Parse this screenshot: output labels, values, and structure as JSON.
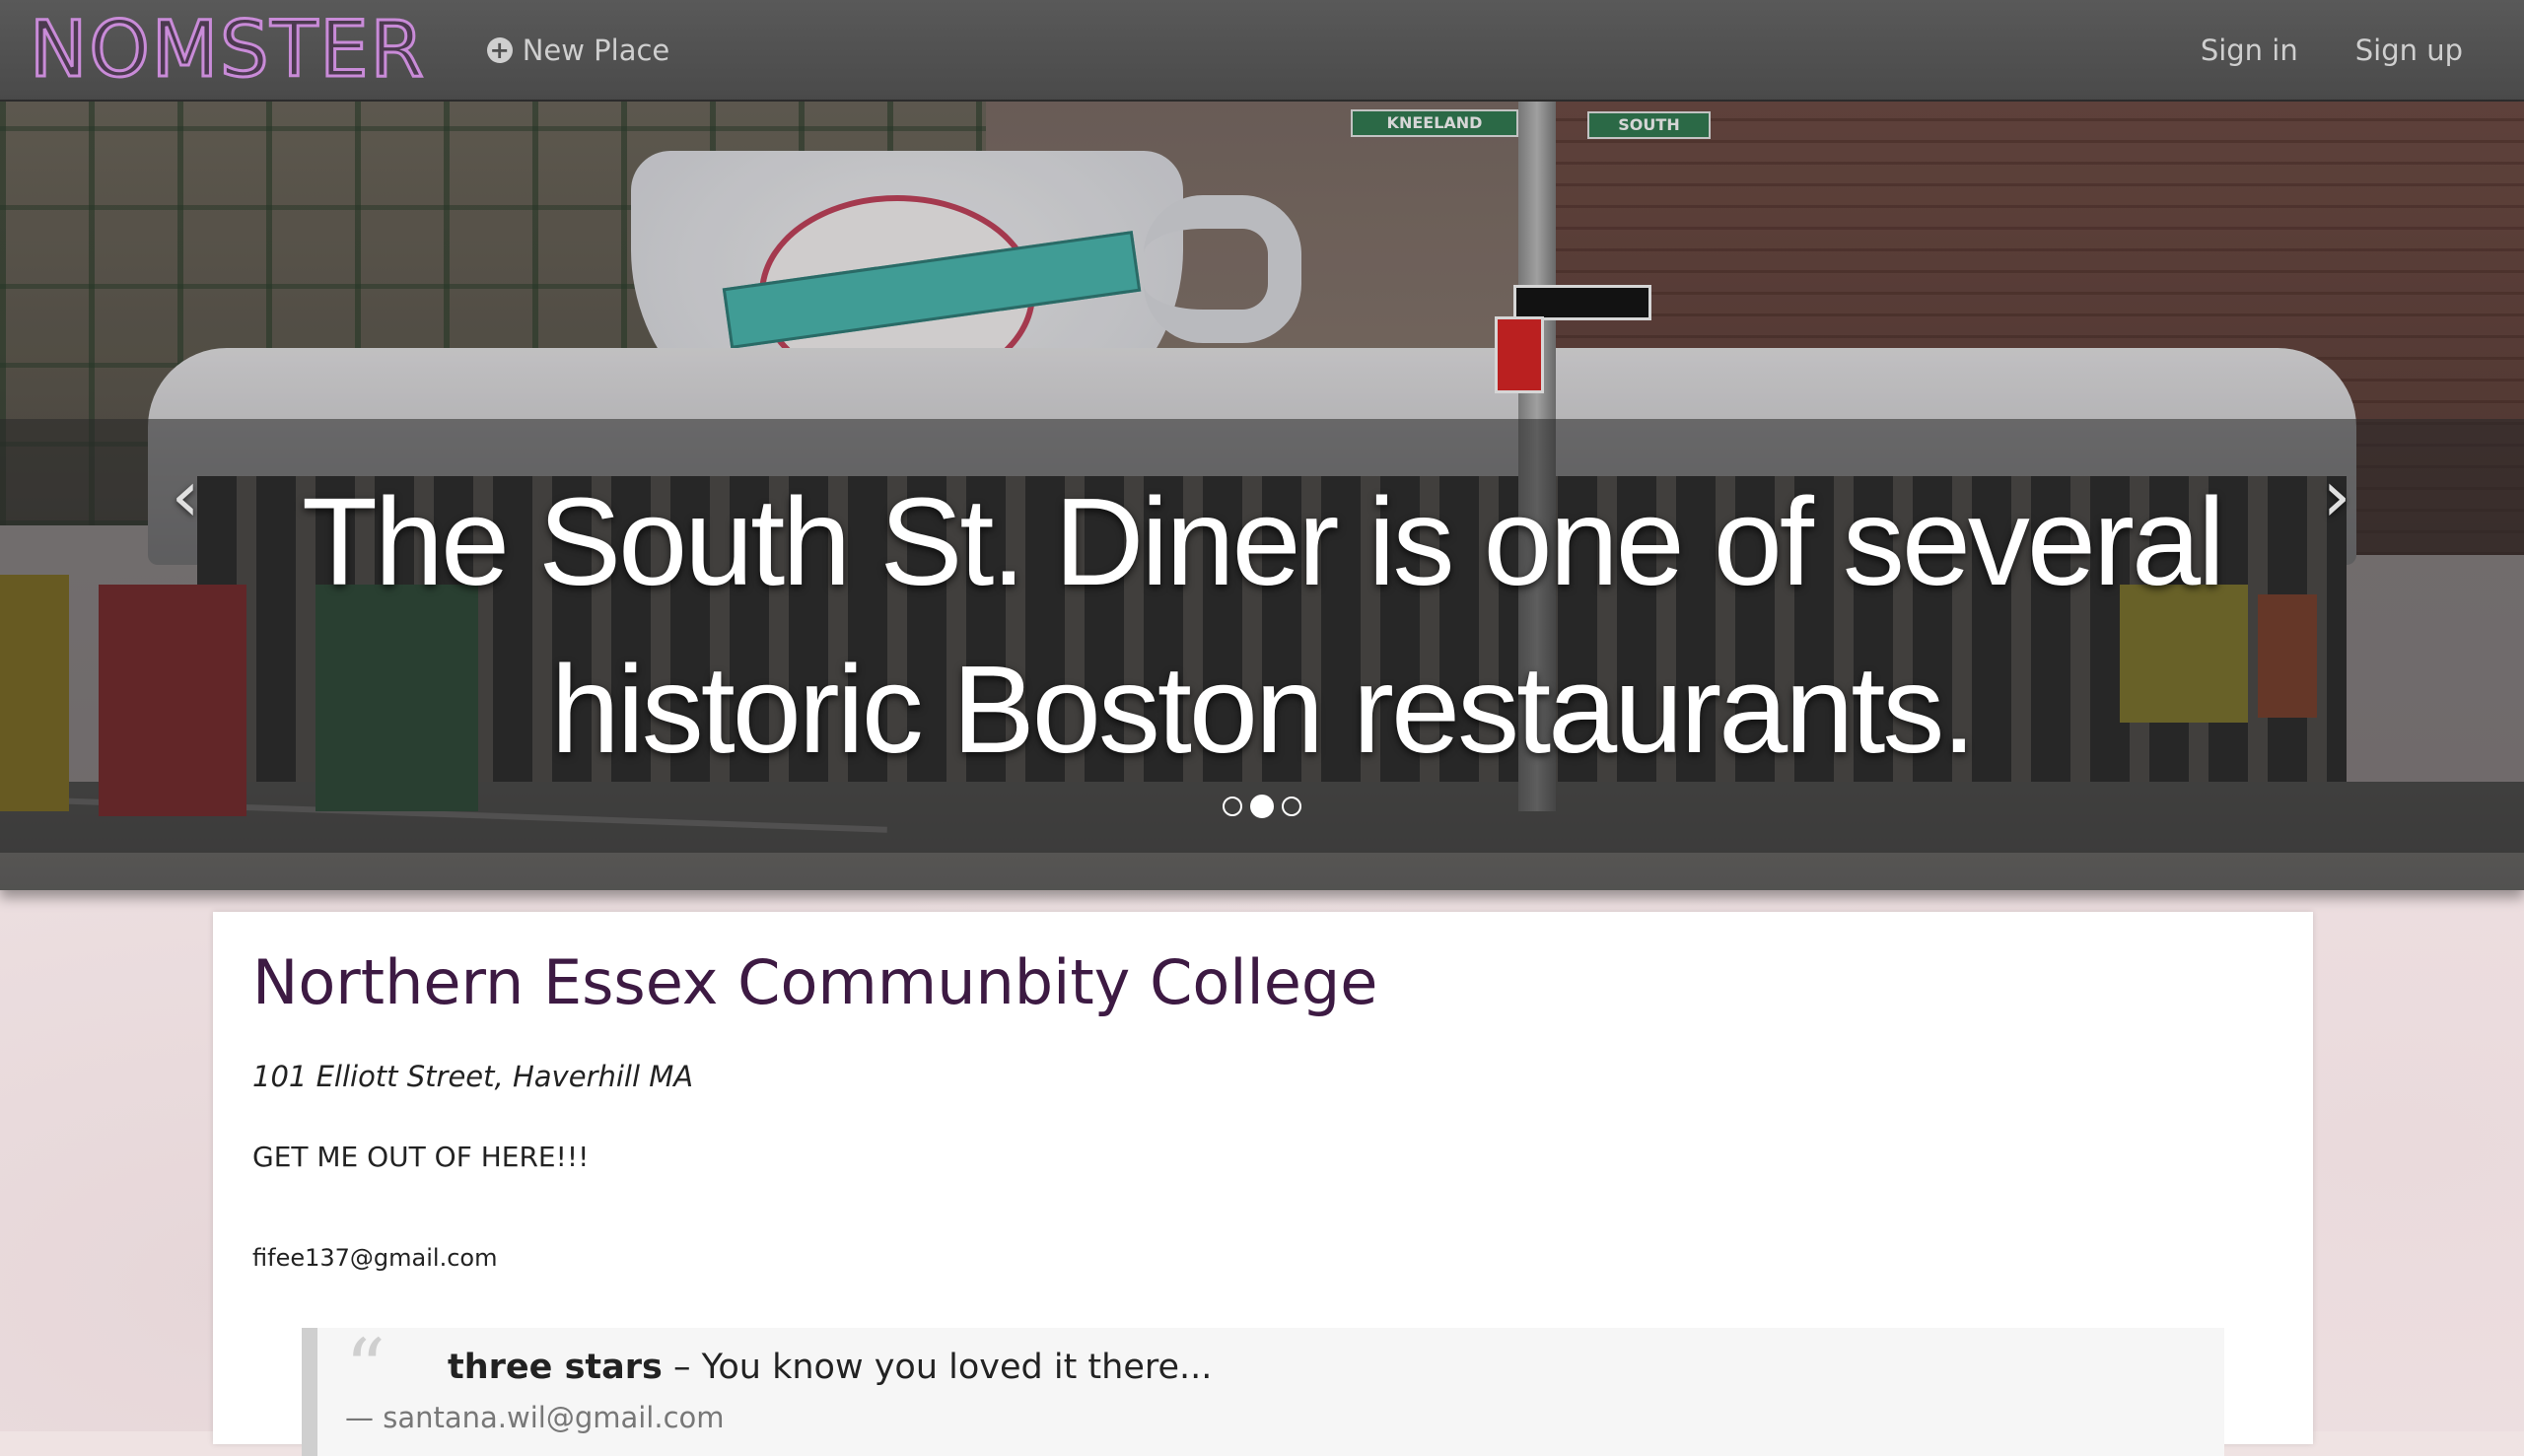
{
  "navbar": {
    "brand": "NOMSTER",
    "new_place_label": "New Place",
    "sign_in_label": "Sign in",
    "sign_up_label": "Sign up"
  },
  "carousel": {
    "caption": "The South St. Diner is one of several historic Boston restaurants.",
    "prev_icon": "‹",
    "next_icon": "›",
    "slide_count": 3,
    "active_slide": 2,
    "scene_signs": {
      "street_left": "KNEELAND",
      "street_right": "SOUTH"
    }
  },
  "place": {
    "name": "Northern Essex Communbity College",
    "address": "101 Elliott Street, Haverhill MA",
    "description": "GET ME OUT OF HERE!!!",
    "owner_email": "fifee137@gmail.com"
  },
  "review": {
    "rating": "three stars",
    "separator": " – ",
    "comment": "You know you loved it there...",
    "author": "— santana.wil@gmail.com"
  },
  "colors": {
    "brand_outline": "#c98bd8",
    "title": "#3d1a43",
    "navbar": "#505050"
  }
}
